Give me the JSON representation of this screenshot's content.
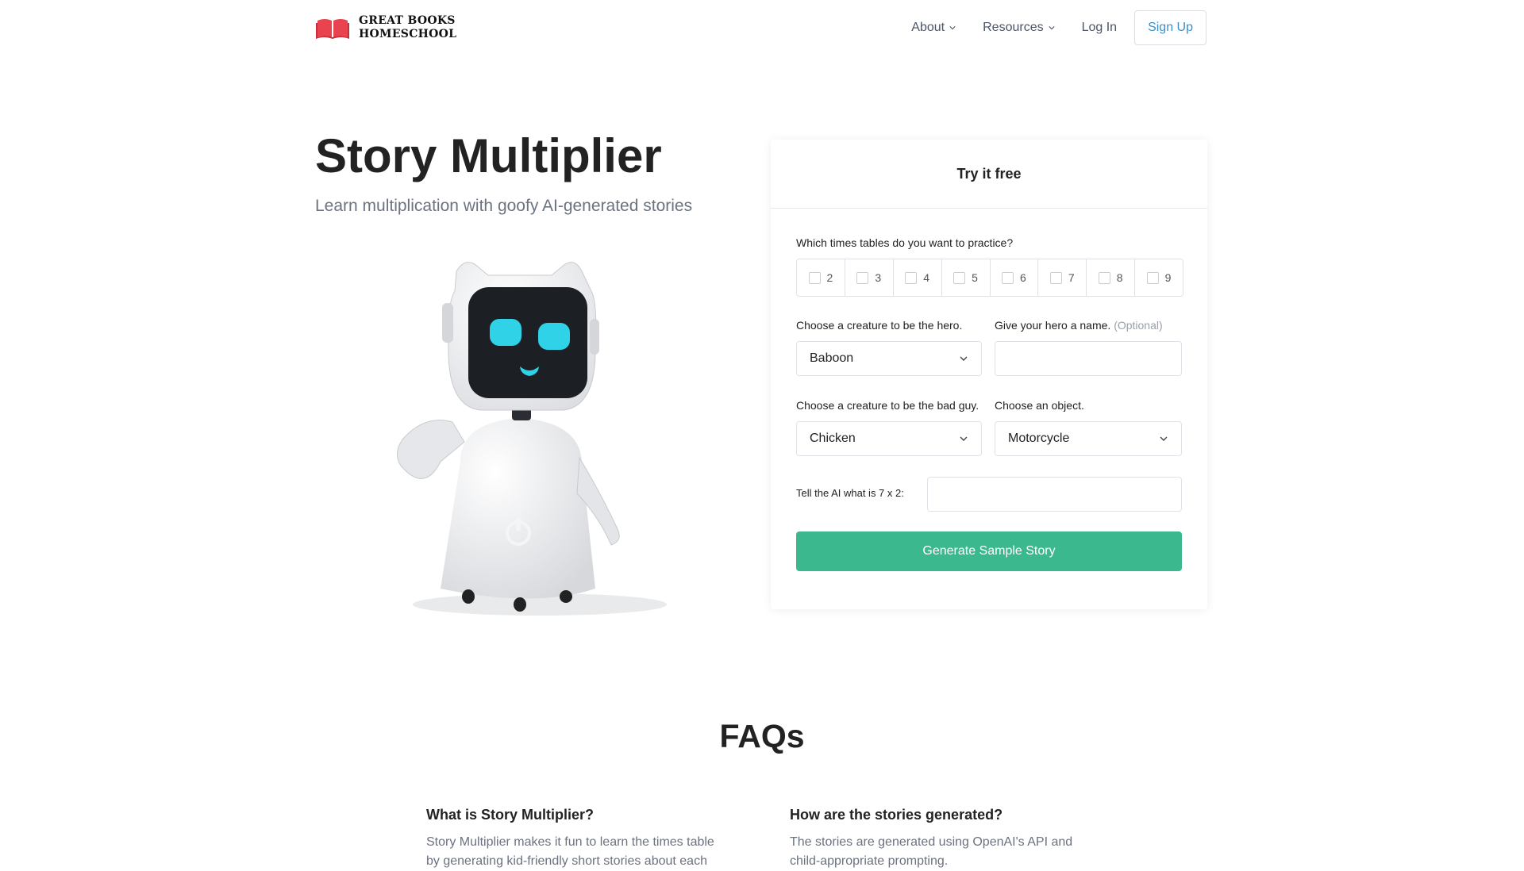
{
  "brand": {
    "line1": "GREAT BOOKS",
    "line2": "HOMESCHOOL",
    "brand_color": "#e8434f"
  },
  "nav": {
    "about": "About",
    "resources": "Resources",
    "login": "Log In",
    "signup": "Sign Up"
  },
  "hero": {
    "title": "Story Multiplier",
    "subtitle": "Learn multiplication with goofy AI-generated stories"
  },
  "form": {
    "heading": "Try it free",
    "tables_label": "Which times tables do you want to practice?",
    "tables": [
      "2",
      "3",
      "4",
      "5",
      "6",
      "7",
      "8",
      "9"
    ],
    "hero_label": "Choose a creature to be the hero.",
    "hero_value": "Baboon",
    "name_label": "Give your hero a name.",
    "name_optional": "(Optional)",
    "name_value": "",
    "badguy_label": "Choose a creature to be the bad guy.",
    "badguy_value": "Chicken",
    "object_label": "Choose an object.",
    "object_value": "Motorcycle",
    "captcha_label": "Tell the AI what is 7 x 2:",
    "captcha_value": "",
    "submit_label": "Generate Sample Story",
    "accent_color": "#3cb88f"
  },
  "faq": {
    "title": "FAQs",
    "items": [
      {
        "q": "What is Story Multiplier?",
        "a": "Story Multiplier makes it fun to learn the times table by generating kid-friendly short stories about each"
      },
      {
        "q": "How are the stories generated?",
        "a": "The stories are generated using OpenAI's API and child-appropriate prompting."
      }
    ]
  }
}
